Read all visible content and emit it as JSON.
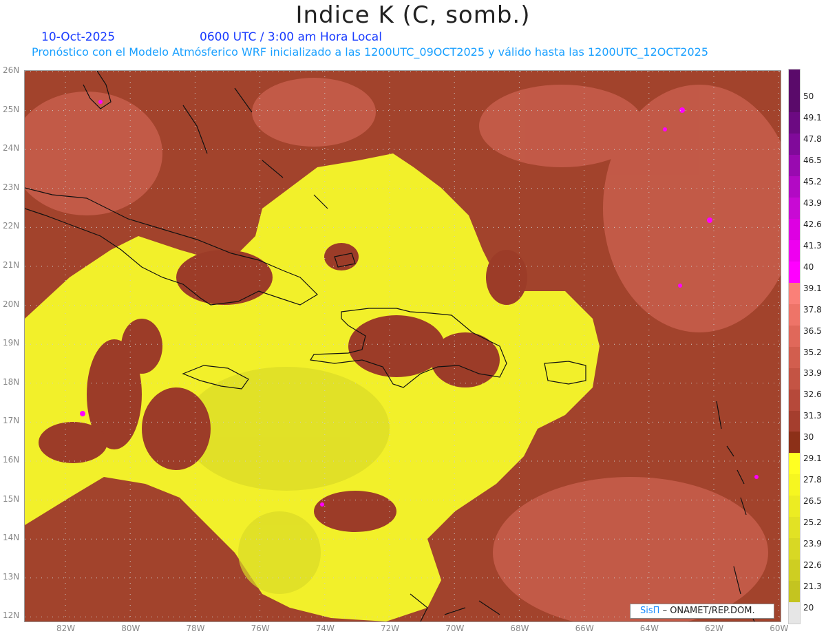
{
  "header": {
    "title": "Indice K (C, somb.)",
    "date": "10-Oct-2025",
    "time": "0600 UTC / 3:00 am Hora Local",
    "subtitle": "Pronóstico con el Modelo Atmósferico WRF inicializado a las 1200UTC_09OCT2025 y válido hasta las  1200UTC_12OCT2025"
  },
  "map": {
    "lat_labels": [
      "26N",
      "25N",
      "24N",
      "23N",
      "22N",
      "21N",
      "20N",
      "19N",
      "18N",
      "17N",
      "16N",
      "15N",
      "14N",
      "13N",
      "12N"
    ],
    "lon_labels": [
      "82W",
      "80W",
      "78W",
      "76W",
      "74W",
      "72W",
      "70W",
      "68W",
      "66W",
      "64W",
      "62W",
      "60W"
    ],
    "extent": {
      "lon": [
        -83.25,
        -60
      ],
      "lat": [
        12,
        26.1
      ]
    }
  },
  "colorbar": {
    "labels": [
      "50",
      "49.1",
      "47.8",
      "46.5",
      "45.2",
      "43.9",
      "42.6",
      "41.3",
      "40",
      "39.1",
      "37.8",
      "36.5",
      "35.2",
      "33.9",
      "32.6",
      "31.3",
      "30",
      "29.1",
      "27.8",
      "26.5",
      "25.2",
      "23.9",
      "22.6",
      "21.3",
      "20"
    ],
    "colors": [
      "#5a0a6a",
      "#6c0a82",
      "#800a9a",
      "#990ab0",
      "#b20ac4",
      "#c80ad4",
      "#dd00e2",
      "#ee00f0",
      "#ff00ff",
      "#fa8078",
      "#ee7468",
      "#e0685a",
      "#d25e4e",
      "#c45444",
      "#b6493a",
      "#a53e2e",
      "#8c3018",
      "#ffff22",
      "#f6f620",
      "#ecec22",
      "#e2e224",
      "#d8d824",
      "#cece22",
      "#c4c420",
      "#e6e6e6"
    ]
  },
  "credit": {
    "brand": "SisΠ",
    "text": "– ONAMET/REP.DOM."
  }
}
